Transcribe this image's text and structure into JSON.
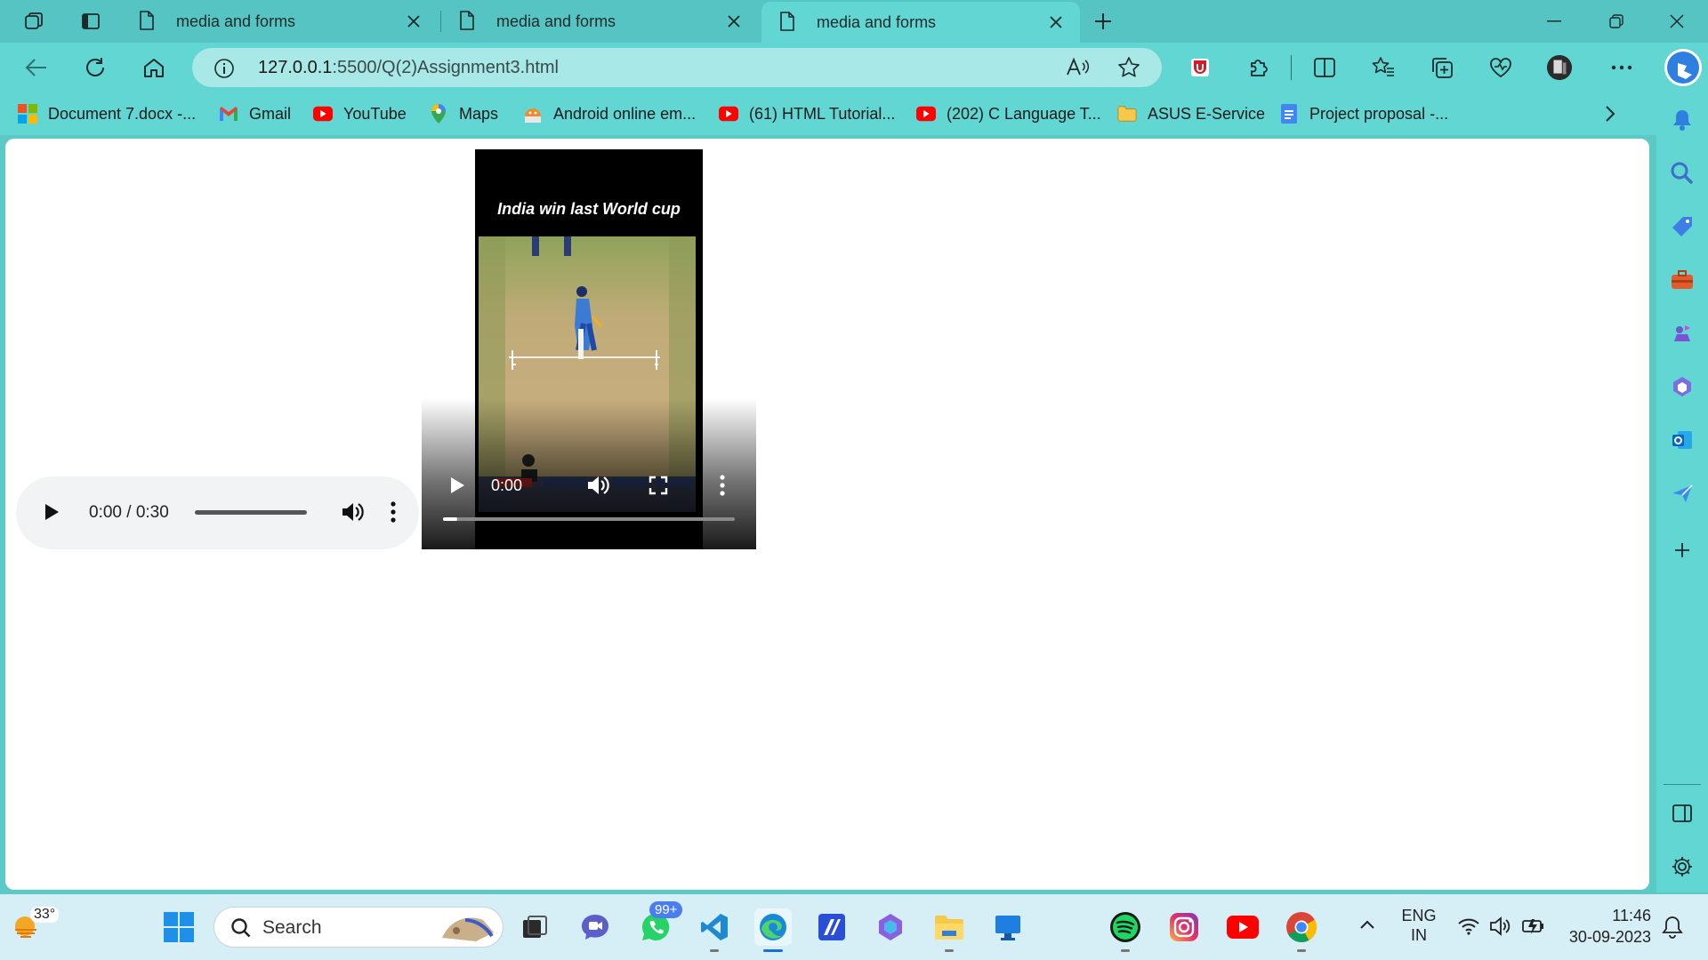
{
  "browser": {
    "tabs": [
      {
        "title": "media and forms",
        "active": false
      },
      {
        "title": "media and forms",
        "active": false
      },
      {
        "title": "media and forms",
        "active": true
      }
    ],
    "address": {
      "host": "127.0.0.1",
      "path": ":5500/Q(2)Assignment3.html"
    },
    "bookmarks": [
      {
        "label": "Document 7.docx -...",
        "icon": "windows-icon"
      },
      {
        "label": "Gmail",
        "icon": "gmail-icon"
      },
      {
        "label": "YouTube",
        "icon": "youtube-icon"
      },
      {
        "label": "Maps",
        "icon": "maps-icon"
      },
      {
        "label": "Android online em...",
        "icon": "android-emulator-icon"
      },
      {
        "label": "(61) HTML Tutorial...",
        "icon": "youtube-icon"
      },
      {
        "label": "(202) C Language T...",
        "icon": "youtube-icon"
      },
      {
        "label": "ASUS E-Service",
        "icon": "folder-icon"
      },
      {
        "label": "Project proposal -...",
        "icon": "docs-icon"
      }
    ]
  },
  "page": {
    "audio": {
      "time": "0:00 / 0:30"
    },
    "video": {
      "caption": "India win last World cup",
      "time": "0:00",
      "progress": 0.05
    }
  },
  "taskbar": {
    "weather_temp": "33°",
    "search_label": "Search",
    "whatsapp_badge": "99+",
    "language_line1": "ENG",
    "language_line2": "IN",
    "clock_time": "11:46",
    "clock_date": "30-09-2023"
  },
  "colors": {
    "frame": "#5cc9c6",
    "toolbar": "#62d6d3",
    "omnibox": "#a8e8e6",
    "taskbar": "#d6eef6"
  }
}
